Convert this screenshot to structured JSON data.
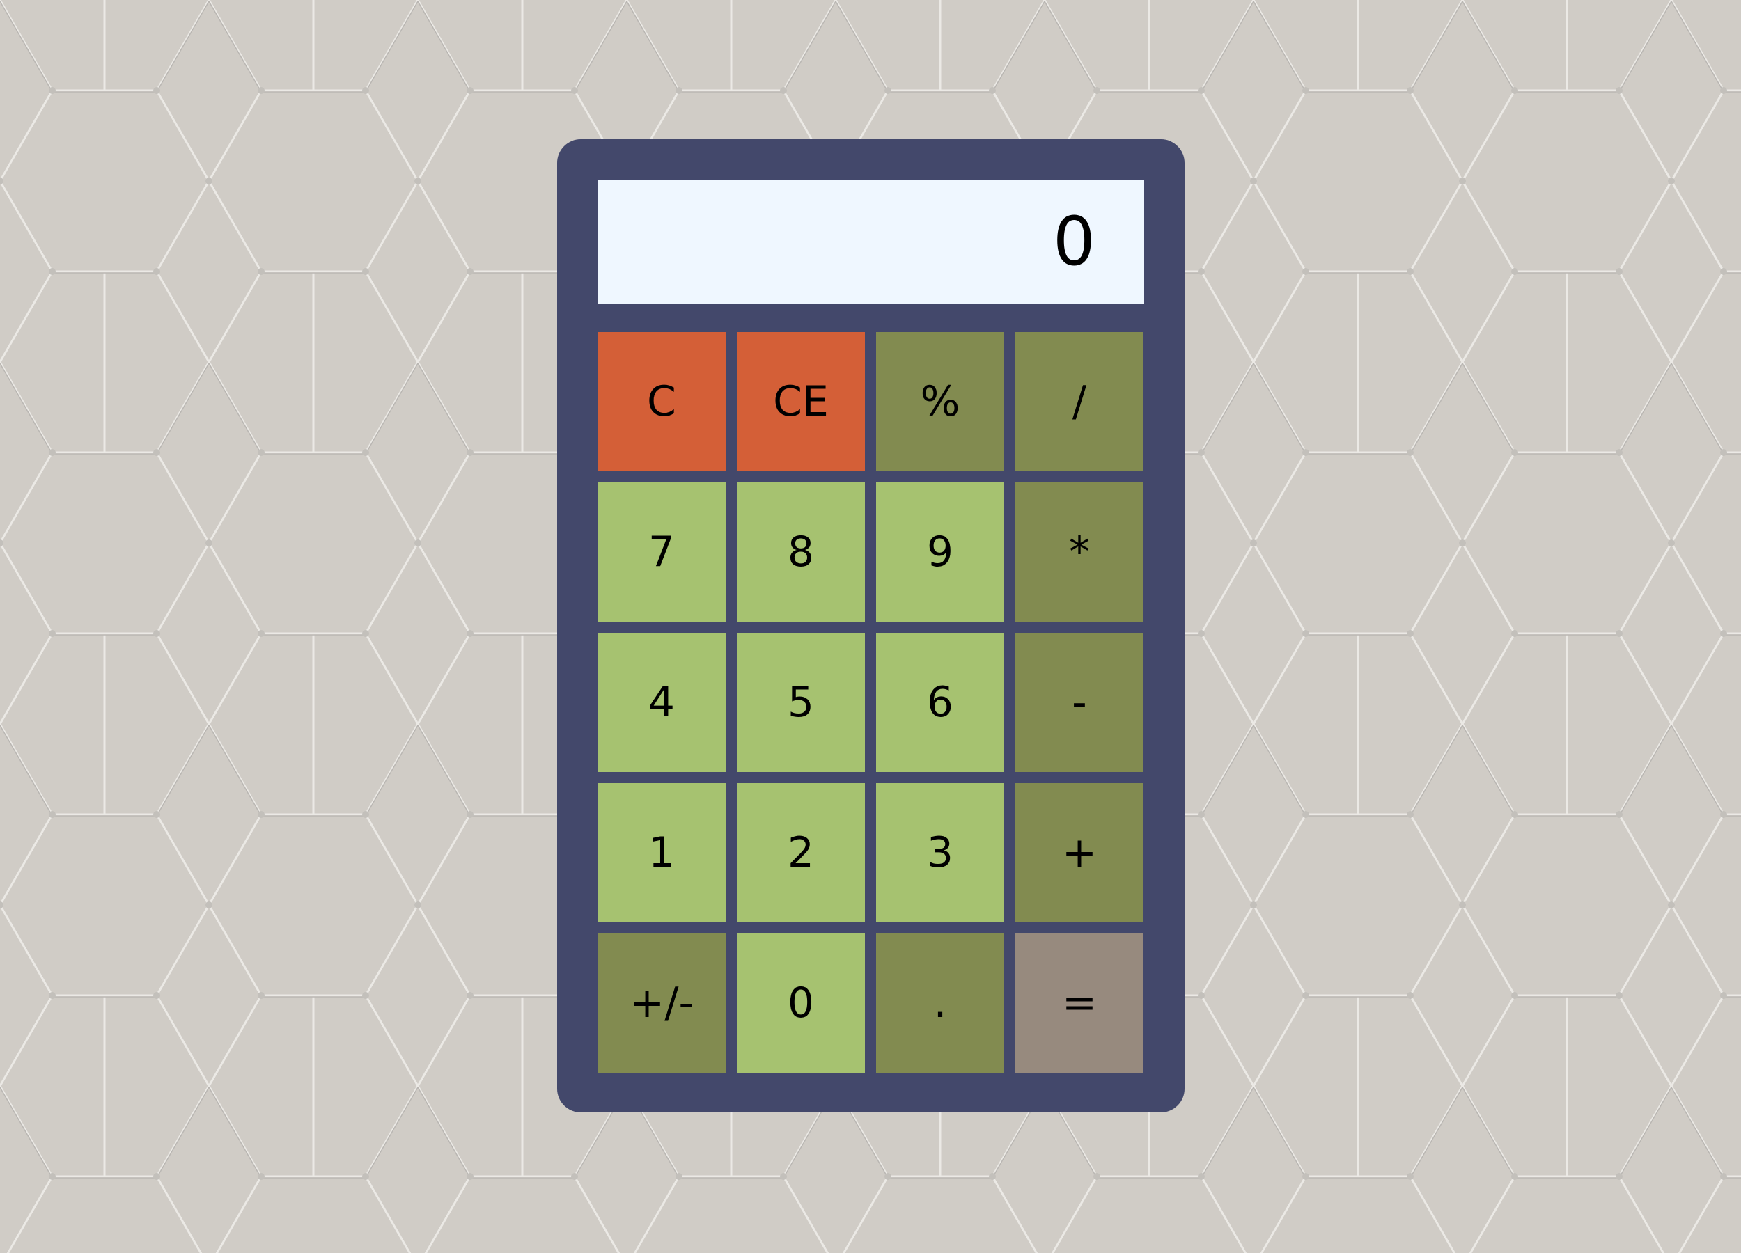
{
  "display": {
    "value": "0"
  },
  "colors": {
    "background": "#d0ccc6",
    "pattern_line": "#ebe9e5",
    "body": "#43486b",
    "display_bg": "#eff7ff",
    "clear_key": "#d45f37",
    "operator_key": "#828b50",
    "digit_key": "#a6c270",
    "equals_key": "#978a7e"
  },
  "keys": [
    {
      "label": "C",
      "kind": "clear_key",
      "name": "clear-button"
    },
    {
      "label": "CE",
      "kind": "clear_key",
      "name": "clear-entry-button"
    },
    {
      "label": "%",
      "kind": "operator_key",
      "name": "percent-button"
    },
    {
      "label": "/",
      "kind": "operator_key",
      "name": "divide-button"
    },
    {
      "label": "7",
      "kind": "digit_key",
      "name": "digit-7-button"
    },
    {
      "label": "8",
      "kind": "digit_key",
      "name": "digit-8-button"
    },
    {
      "label": "9",
      "kind": "digit_key",
      "name": "digit-9-button"
    },
    {
      "label": "*",
      "kind": "operator_key",
      "name": "multiply-button"
    },
    {
      "label": "4",
      "kind": "digit_key",
      "name": "digit-4-button"
    },
    {
      "label": "5",
      "kind": "digit_key",
      "name": "digit-5-button"
    },
    {
      "label": "6",
      "kind": "digit_key",
      "name": "digit-6-button"
    },
    {
      "label": "-",
      "kind": "operator_key",
      "name": "subtract-button"
    },
    {
      "label": "1",
      "kind": "digit_key",
      "name": "digit-1-button"
    },
    {
      "label": "2",
      "kind": "digit_key",
      "name": "digit-2-button"
    },
    {
      "label": "3",
      "kind": "digit_key",
      "name": "digit-3-button"
    },
    {
      "label": "+",
      "kind": "operator_key",
      "name": "add-button"
    },
    {
      "label": "+/-",
      "kind": "operator_key",
      "name": "toggle-sign-button"
    },
    {
      "label": "0",
      "kind": "digit_key",
      "name": "digit-0-button"
    },
    {
      "label": ".",
      "kind": "operator_key",
      "name": "decimal-button"
    },
    {
      "label": "=",
      "kind": "equals_key",
      "name": "equals-button"
    }
  ]
}
